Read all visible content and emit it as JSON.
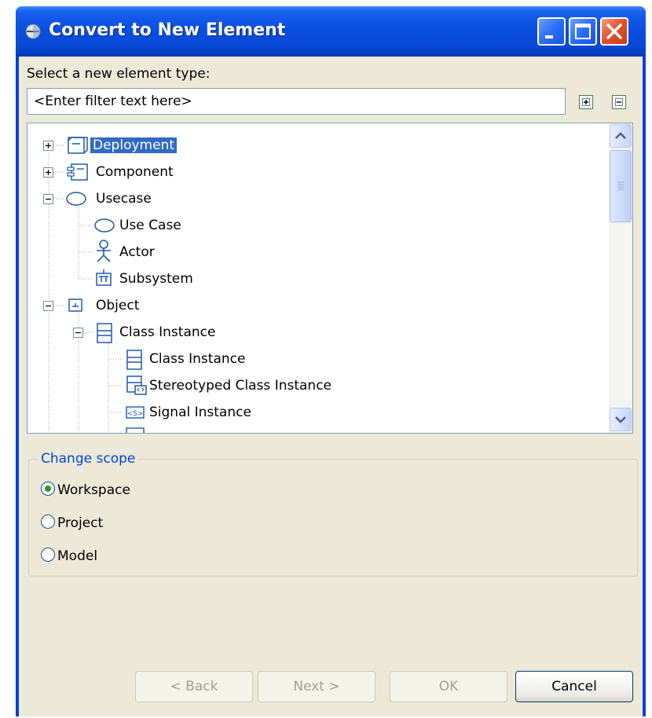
{
  "window": {
    "title": "Convert to New Element",
    "controls": [
      "minimize-icon",
      "maximize-icon",
      "close-icon"
    ]
  },
  "prompt_label": "Select a new element type:",
  "filter": {
    "value": "<Enter filter text here>"
  },
  "tree": {
    "items": [
      {
        "label": "Deployment",
        "selected": true,
        "icon": "deployment-icon"
      },
      {
        "label": "Component",
        "icon": "component-icon"
      },
      {
        "label": "Usecase",
        "icon": "usecase-icon"
      },
      {
        "label": "Use Case",
        "icon": "usecase-icon"
      },
      {
        "label": "Actor",
        "icon": "actor-icon"
      },
      {
        "label": "Subsystem",
        "icon": "subsystem-icon"
      },
      {
        "label": "Object",
        "icon": "object-icon"
      },
      {
        "label": "Class Instance",
        "icon": "class-instance-icon"
      },
      {
        "label": "Class Instance",
        "icon": "class-instance-icon"
      },
      {
        "label": "Stereotyped Class Instance",
        "icon": "stereotyped-class-instance-icon"
      },
      {
        "label": "Signal Instance",
        "icon": "signal-instance-icon"
      }
    ]
  },
  "scope": {
    "legend": "Change scope",
    "options": [
      {
        "label": "Workspace",
        "checked": true
      },
      {
        "label": "Project",
        "checked": false
      },
      {
        "label": "Model",
        "checked": false
      }
    ]
  },
  "buttons": {
    "back": "< Back",
    "next": "Next >",
    "ok": "OK",
    "cancel": "Cancel"
  },
  "colors": {
    "titlebar": "#0a4fe0",
    "selection": "#316ac5",
    "group_legend": "#0046d5",
    "radio_dot": "#21a121"
  }
}
